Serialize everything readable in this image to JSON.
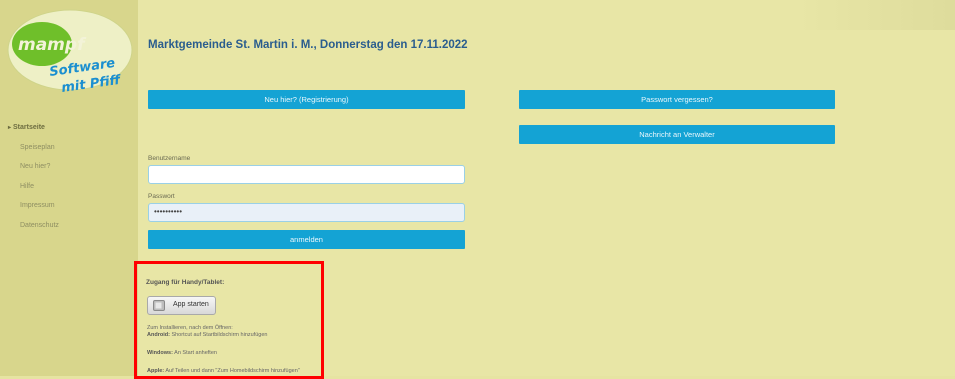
{
  "logo": {
    "brand": "mampf",
    "tagline_1": "Software",
    "tagline_2": "mit Pfiff"
  },
  "sidebar": {
    "items": [
      {
        "label": "Startseite",
        "active": true
      },
      {
        "label": "Speiseplan"
      },
      {
        "label": "Neu hier?"
      },
      {
        "label": "Hilfe"
      },
      {
        "label": "Impressum"
      },
      {
        "label": "Datenschutz"
      }
    ]
  },
  "header": {
    "title": "Marktgemeinde St. Martin i. M., Donnerstag den 17.11.2022"
  },
  "buttons": {
    "register": "Neu hier? (Registrierung)",
    "forgot_password": "Passwort vergessen?",
    "message_admin": "Nachricht an Verwalter",
    "login": "anmelden"
  },
  "form": {
    "username_label": "Benutzername",
    "username_value": "",
    "password_label": "Passwort",
    "password_value": "••••••••••"
  },
  "mobile": {
    "heading": "Zugang für Handy/Tablet:",
    "app_button": "App starten",
    "install_line": "Zum Installieren, nach dem Öffnen:",
    "android_label": "Android:",
    "android_text": " Shortcut auf Startbildschirm hinzufügen",
    "windows_label": "Windows:",
    "windows_text": " An Start anheften",
    "apple_label": "Apple:",
    "apple_text": " Auf Teilen und dann \"Zum Homebildschirm hinzufügen\""
  },
  "colors": {
    "accent": "#14a3d4",
    "title": "#2a5d8e",
    "highlight_border": "#ff0000",
    "background": "#e8e6a6",
    "sidebar": "#d8d68c"
  }
}
